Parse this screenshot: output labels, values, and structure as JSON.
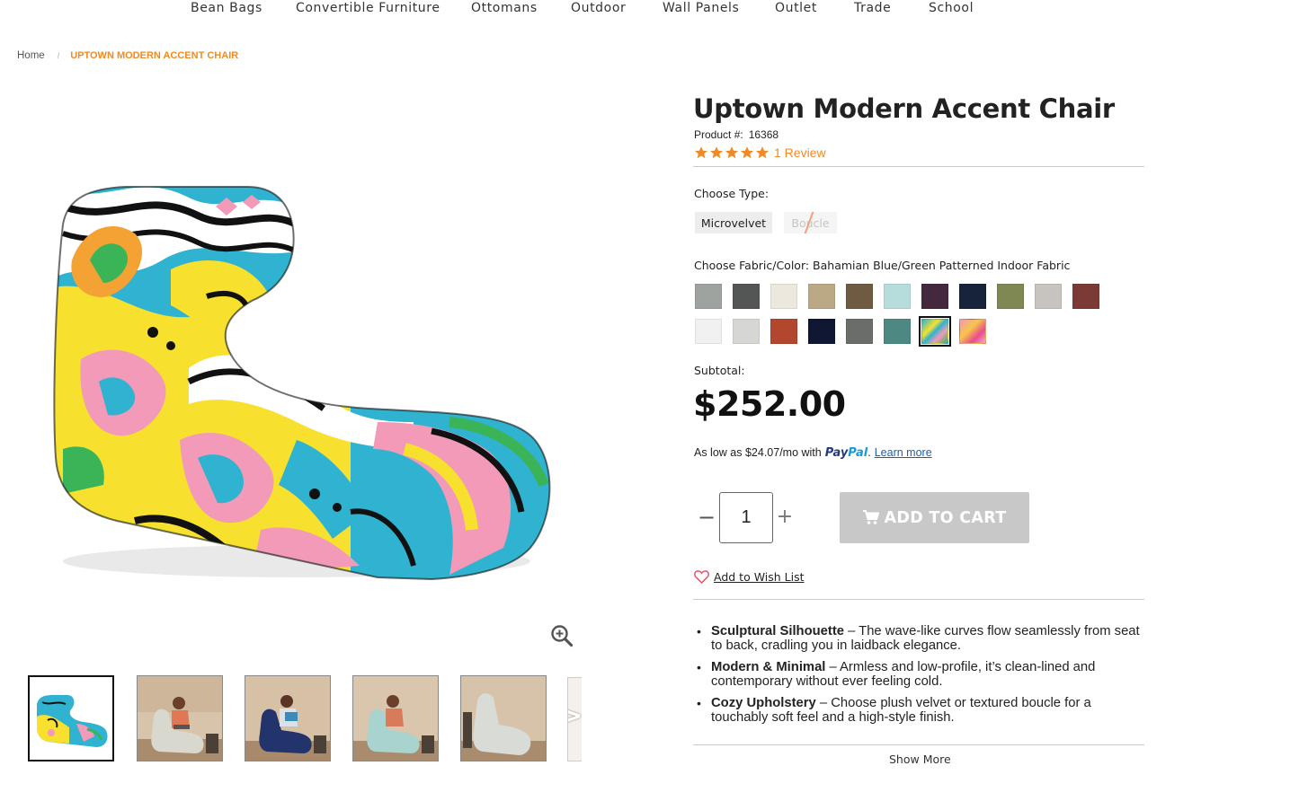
{
  "nav": [
    "Bean Bags",
    "Convertible Furniture",
    "Ottomans",
    "Outdoor",
    "Wall Panels",
    "Outlet",
    "Trade",
    "School"
  ],
  "breadcrumb": {
    "home": "Home",
    "separator": "/",
    "current": "UPTOWN MODERN ACCENT CHAIR"
  },
  "product": {
    "title": "Uptown Modern Accent Chair",
    "number_label": "Product #:",
    "number": "16368",
    "stars": 5,
    "review_text": "1 Review"
  },
  "type": {
    "label": "Choose Type:",
    "options": [
      {
        "label": "Microvelvet",
        "selected": true,
        "available": true
      },
      {
        "label": "Boucle",
        "selected": false,
        "available": false
      }
    ]
  },
  "fabric": {
    "label": "Choose Fabric/Color: Bahamian Blue/Green Patterned Indoor Fabric",
    "swatches": [
      {
        "color": "#9ea3a0"
      },
      {
        "color": "#545555"
      },
      {
        "color": "#ece8dd"
      },
      {
        "color": "#bba884"
      },
      {
        "color": "#6e5b42"
      },
      {
        "color": "#b7dcdc"
      },
      {
        "color": "#43283e"
      },
      {
        "color": "#16233a"
      },
      {
        "color": "#7f8753"
      },
      {
        "color": "#c7c3be"
      },
      {
        "color": "#7b3a35"
      },
      {
        "color": "#f1f1f1"
      },
      {
        "color": "#d6d6d4"
      },
      {
        "color": "#b2472d"
      },
      {
        "color": "#0f1733"
      },
      {
        "color": "#6b6d6a"
      },
      {
        "color": "#4e8883"
      },
      {
        "color": "pattern-teal",
        "selected": true
      },
      {
        "color": "pattern-pink"
      }
    ]
  },
  "subtotal_label": "Subtotal:",
  "price": "$252.00",
  "paypal": {
    "prefix": "As low as $24.07/mo with",
    "logo_a": "Pay",
    "logo_b": "Pal",
    "after": ".",
    "learn_more": "Learn more"
  },
  "quantity": "1",
  "qty_minus": "−",
  "qty_plus": "+",
  "cart_label": "ADD TO CART",
  "wishlist": "Add to Wish List",
  "features": [
    {
      "title": "Sculptural Silhouette",
      "text": " – The wave-like curves flow seamlessly from seat to back, cradling you in laidback elegance."
    },
    {
      "title": "Modern & Minimal",
      "text": " – Armless and low-profile, it’s clean-lined and contemporary without ever feeling cold."
    },
    {
      "title": "Cozy Upholstery",
      "text": " – Choose plush velvet or textured boucle for a touchably soft feel and a high-style finish."
    }
  ],
  "show_more": "Show More",
  "thumb_next": ">",
  "icons": {
    "zoom": "zoom-in-icon",
    "cart": "cart-icon",
    "heart": "heart-icon",
    "star": "star-icon"
  },
  "colors": {
    "accent": "#f08a24",
    "cart_button": "#c8c8c8",
    "paypal_dark": "#253b80",
    "paypal_light": "#179bd7"
  }
}
